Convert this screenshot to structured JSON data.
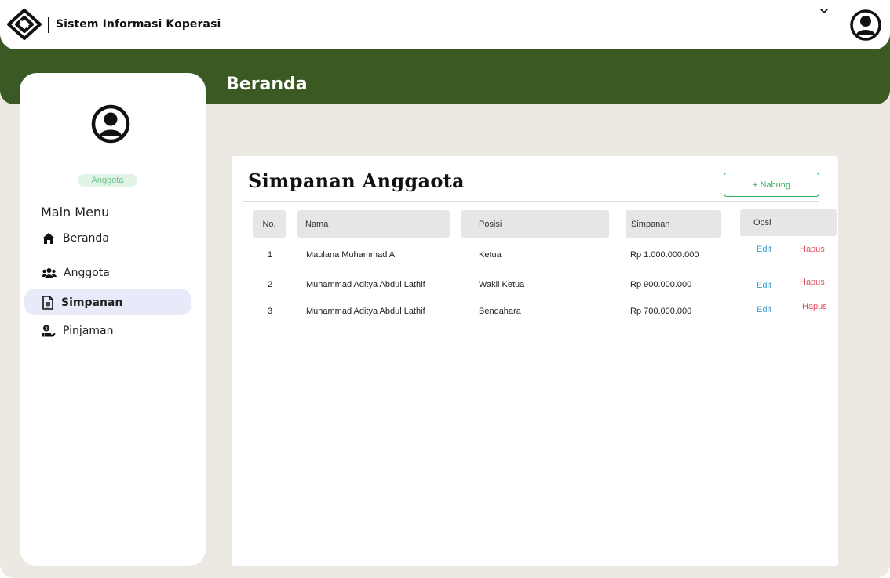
{
  "header": {
    "app_title": "Sistem Informasi Koperasi",
    "page_title": "Beranda",
    "logo_icon": "diamond-logo-icon",
    "account_icon": "user-circle-icon",
    "menu_icon": "chevron-down-icon"
  },
  "sidebar": {
    "avatar_icon": "user-circle-icon",
    "role": "Anggota",
    "menu_heading": "Main Menu",
    "items": [
      {
        "label": "Beranda",
        "icon": "home-icon",
        "active": false
      },
      {
        "label": "Anggota",
        "icon": "users-icon",
        "active": false
      },
      {
        "label": "Simpanan",
        "icon": "document-icon",
        "active": true
      },
      {
        "label": "Pinjaman",
        "icon": "hand-coin-icon",
        "active": false
      }
    ]
  },
  "main": {
    "title": "Simpanan Anggaota",
    "add_button": "+ Nabung",
    "columns": [
      "No.",
      "Nama",
      "Posisi",
      "Simpanan",
      "Opsi"
    ],
    "rows": [
      {
        "no": "1",
        "nama": "Maulana Muhammad A",
        "posisi": "Ketua",
        "simpanan": "Rp 1.000.000.000",
        "edit": "Edit",
        "hapus": "Hapus"
      },
      {
        "no": "2",
        "nama": "Muhammad Aditya Abdul Lathif",
        "posisi": "Wakil Ketua",
        "simpanan": "Rp 900.000.000",
        "edit": "Edit",
        "hapus": "Hapus"
      },
      {
        "no": "3",
        "nama": "Muhammad Aditya Abdul Lathif",
        "posisi": "Bendahara",
        "simpanan": "Rp 700.000.000",
        "edit": "Edit",
        "hapus": "Hapus"
      }
    ]
  },
  "colors": {
    "brand_green": "#3b5a23",
    "background": "#ece8e2",
    "accent_green": "#2fae5e",
    "edit_blue": "#3a9fd6",
    "delete_red": "#e0505f",
    "active_item_bg": "#e8eafa"
  }
}
